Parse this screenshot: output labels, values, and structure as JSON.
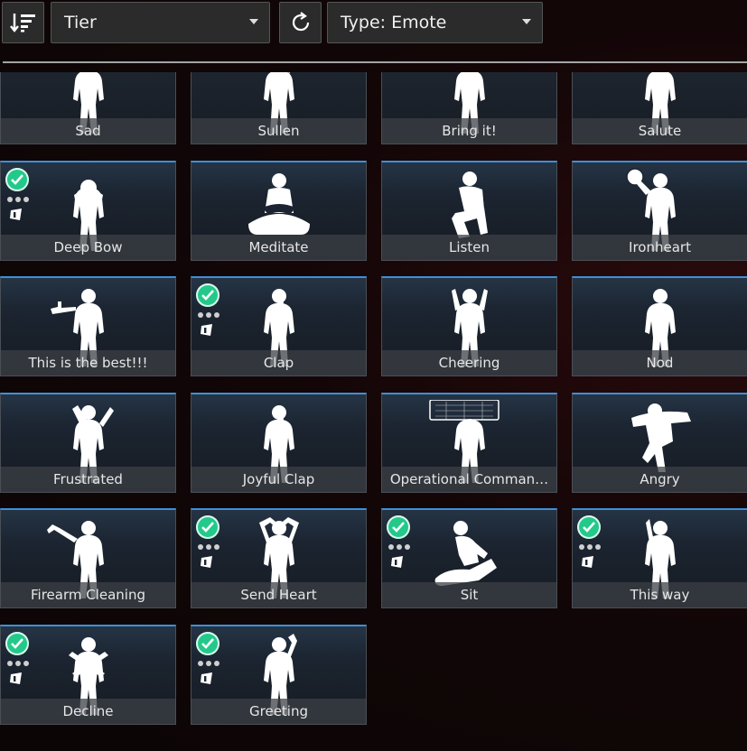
{
  "toolbar": {
    "sort_icon": "sort-descending-icon",
    "sort_select_value": "Tier",
    "refresh_icon": "refresh-icon",
    "type_select_value": "Type: Emote"
  },
  "emotes": [
    {
      "label": "Sad",
      "owned": false,
      "pose": "stand"
    },
    {
      "label": "Sullen",
      "owned": false,
      "pose": "hand-head"
    },
    {
      "label": "Bring it!",
      "owned": false,
      "pose": "stand"
    },
    {
      "label": "Salute",
      "owned": false,
      "pose": "stand"
    },
    {
      "label": "Deep Bow",
      "owned": true,
      "pose": "bow"
    },
    {
      "label": "Meditate",
      "owned": false,
      "pose": "sit-cross"
    },
    {
      "label": "Listen",
      "owned": false,
      "pose": "crouch"
    },
    {
      "label": "Ironheart",
      "owned": false,
      "pose": "ball"
    },
    {
      "label": "This is the best!!!",
      "owned": false,
      "pose": "thumb"
    },
    {
      "label": "Clap",
      "owned": true,
      "pose": "clap"
    },
    {
      "label": "Cheering",
      "owned": false,
      "pose": "cheer"
    },
    {
      "label": "Nod",
      "owned": false,
      "pose": "stand"
    },
    {
      "label": "Frustrated",
      "owned": false,
      "pose": "frustrated"
    },
    {
      "label": "Joyful Clap",
      "owned": false,
      "pose": "clap"
    },
    {
      "label": "Operational Comman…",
      "owned": false,
      "pose": "screen"
    },
    {
      "label": "Angry",
      "owned": false,
      "pose": "angry"
    },
    {
      "label": "Firearm Cleaning",
      "owned": false,
      "pose": "gun"
    },
    {
      "label": "Send Heart",
      "owned": true,
      "pose": "heart"
    },
    {
      "label": "Sit",
      "owned": true,
      "pose": "sit"
    },
    {
      "label": "This way",
      "owned": true,
      "pose": "point"
    },
    {
      "label": "Decline",
      "owned": true,
      "pose": "cross"
    },
    {
      "label": "Greeting",
      "owned": true,
      "pose": "wave"
    }
  ]
}
